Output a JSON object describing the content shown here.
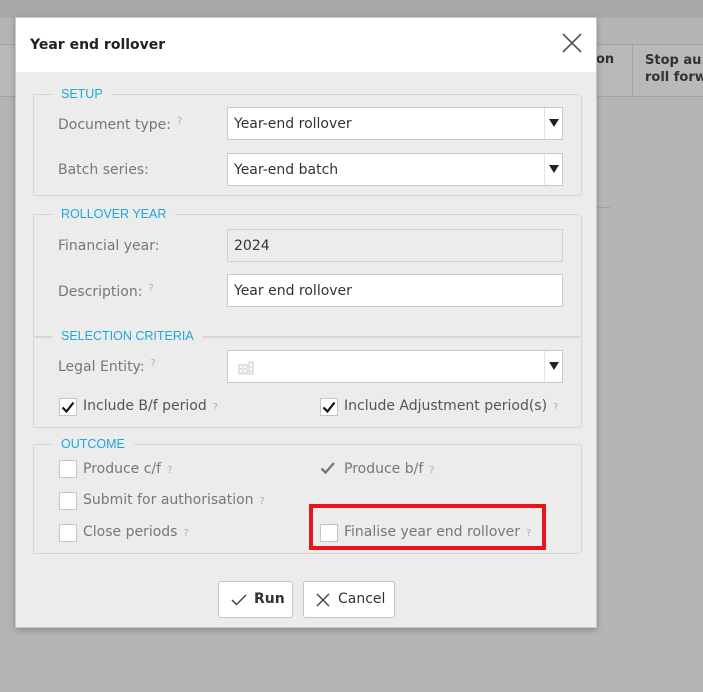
{
  "background": {
    "col_on": "on",
    "col_stop_line1": "Stop au",
    "col_stop_line2": "roll forw"
  },
  "dialog": {
    "title": "Year end rollover",
    "setup": {
      "legend": "SETUP",
      "document_type_label": "Document type:",
      "document_type_value": "Year-end rollover",
      "batch_series_label": "Batch series:",
      "batch_series_value": "Year-end batch"
    },
    "rollover_year": {
      "legend": "ROLLOVER YEAR",
      "financial_year_label": "Financial year:",
      "financial_year_value": "2024",
      "description_label": "Description:",
      "description_value": "Year end rollover"
    },
    "selection_criteria": {
      "legend": "SELECTION CRITERIA",
      "legal_entity_label": "Legal Entity:",
      "legal_entity_value": "",
      "include_bf_label": "Include B/f period",
      "include_bf_checked": true,
      "include_adj_label": "Include Adjustment period(s)",
      "include_adj_checked": true
    },
    "outcome": {
      "legend": "OUTCOME",
      "produce_cf_label": "Produce c/f",
      "produce_bf_label": "Produce b/f",
      "submit_auth_label": "Submit for authorisation",
      "close_periods_label": "Close periods",
      "finalise_label": "Finalise year end rollover"
    },
    "help_mark": "?",
    "run_label": "Run",
    "cancel_label": "Cancel"
  },
  "colors": {
    "legend": "#1ea7d8",
    "highlight": "#e8141c",
    "help": "#b8a6d6"
  }
}
